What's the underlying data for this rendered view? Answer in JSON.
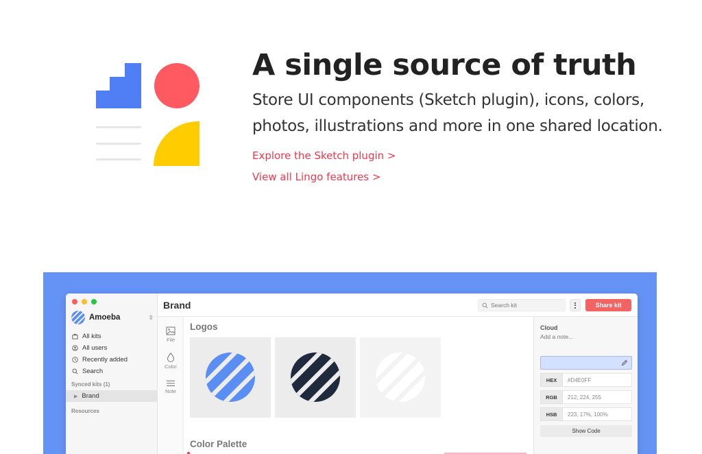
{
  "hero": {
    "title": "A single source of truth",
    "subtitle": "Store UI components (Sketch plugin), icons, colors, photos, illustrations and more in one shared location.",
    "links": [
      "Explore the Sketch plugin >",
      "View all Lingo features >"
    ],
    "art_colors": {
      "blue": "#4f7ef5",
      "red": "#ff5a62",
      "yellow": "#ffcc00",
      "line": "#e6e6e6"
    }
  },
  "app": {
    "workspace": "Amoeba",
    "nav": [
      {
        "label": "All kits",
        "icon": "kit-icon"
      },
      {
        "label": "All users",
        "icon": "user-icon"
      },
      {
        "label": "Recently added",
        "icon": "clock-icon"
      },
      {
        "label": "Search",
        "icon": "search-icon"
      }
    ],
    "synced_kits_label": "Synced kits (1)",
    "kits": [
      "Brand"
    ],
    "resources_label": "Resources",
    "page_title": "Brand",
    "search_placeholder": "Search kit",
    "share_label": "Share kit",
    "tools": [
      "File",
      "Color",
      "Note"
    ],
    "groups": {
      "logos": "Logos",
      "colors": "Color Palette"
    },
    "logo_tiles": [
      {
        "variant": "blue",
        "fill": "#5b8ef2"
      },
      {
        "variant": "dark",
        "fill": "#1f2a3d"
      },
      {
        "variant": "white",
        "fill": "#ffffff"
      }
    ],
    "inspector": {
      "title": "Cloud",
      "note_placeholder": "Add a note...",
      "swatch_color": "#D4E0FF",
      "rows": [
        {
          "label": "HEX",
          "value": "#D4E0FF"
        },
        {
          "label": "RGB",
          "value": "212, 224, 255"
        },
        {
          "label": "HSB",
          "value": "223, 17%, 100%"
        }
      ],
      "show_code": "Show Code"
    },
    "accent": "#f26363",
    "band_color": "#6593f5"
  }
}
